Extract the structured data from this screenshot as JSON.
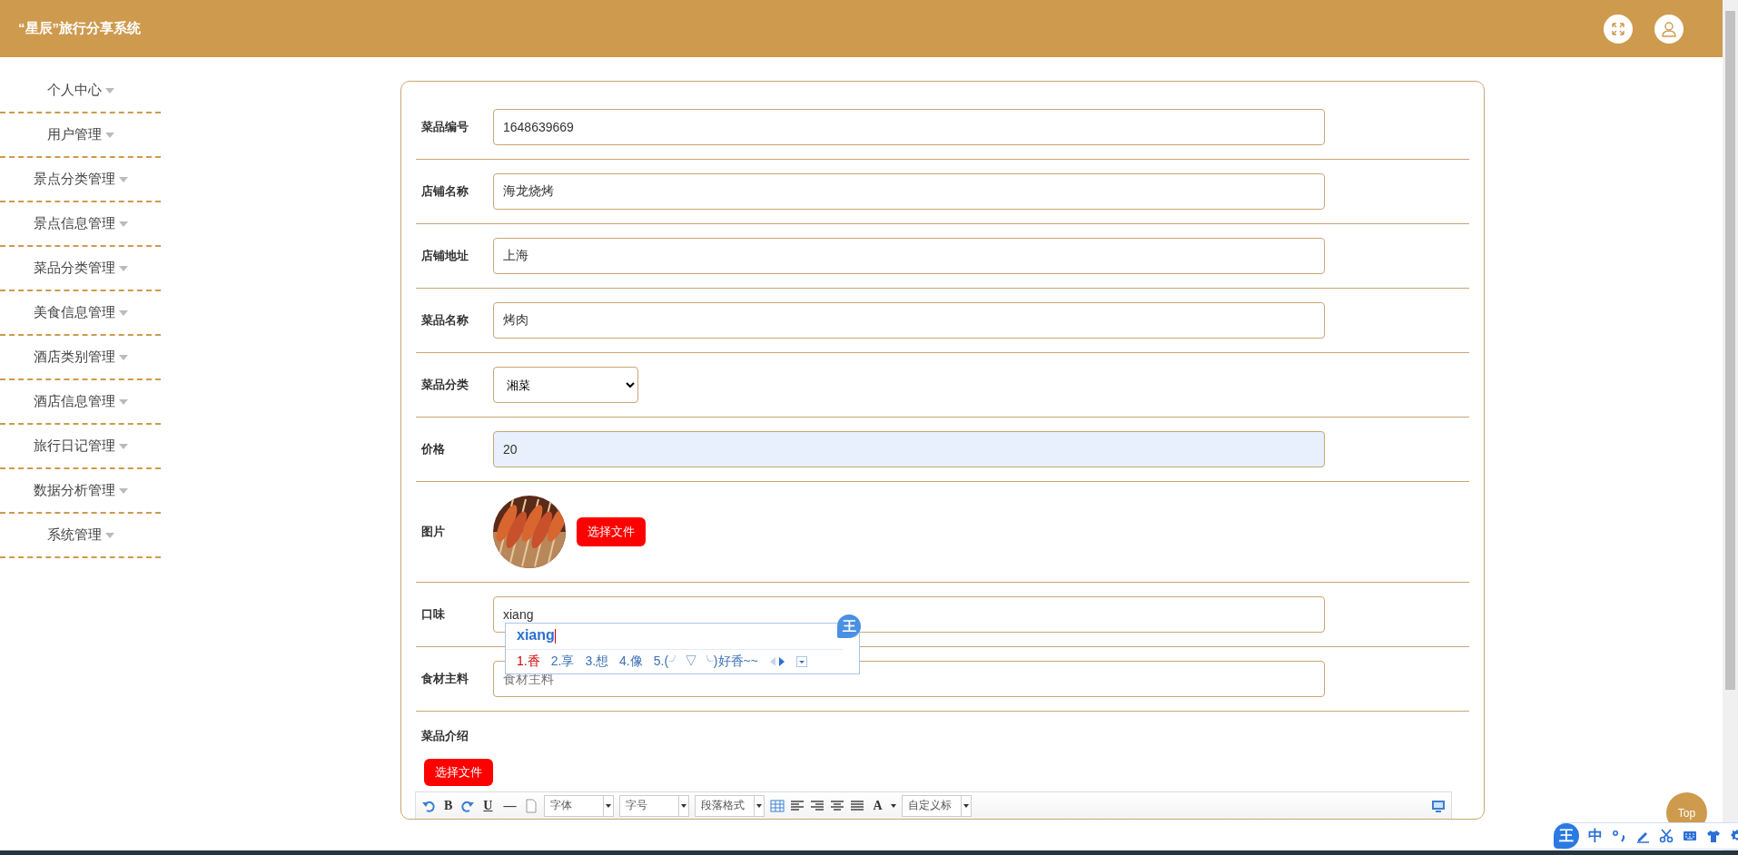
{
  "header": {
    "title": "“星辰”旅行分享系统"
  },
  "sidebar": {
    "items": [
      {
        "label": "个人中心"
      },
      {
        "label": "用户管理"
      },
      {
        "label": "景点分类管理"
      },
      {
        "label": "景点信息管理"
      },
      {
        "label": "菜品分类管理"
      },
      {
        "label": "美食信息管理"
      },
      {
        "label": "酒店类别管理"
      },
      {
        "label": "酒店信息管理"
      },
      {
        "label": "旅行日记管理"
      },
      {
        "label": "数据分析管理"
      },
      {
        "label": "系统管理"
      }
    ]
  },
  "form": {
    "fields": [
      {
        "kind": "text",
        "label": "菜品编号",
        "value": "1648639669",
        "autofilled": false
      },
      {
        "kind": "text",
        "label": "店铺名称",
        "value": "海龙烧烤",
        "autofilled": false
      },
      {
        "kind": "text",
        "label": "店铺地址",
        "value": "上海",
        "autofilled": false
      },
      {
        "kind": "text",
        "label": "菜品名称",
        "value": "烤肉",
        "autofilled": false
      },
      {
        "kind": "select",
        "label": "菜品分类",
        "value": "湘菜"
      },
      {
        "kind": "text",
        "label": "价格",
        "value": "20",
        "autofilled": true
      },
      {
        "label": "图片",
        "button": "选择文件"
      },
      {
        "kind": "text",
        "label": "口味",
        "value": "xiang",
        "autofilled": false,
        "ime": {
          "logo": "王",
          "composition": "xiang",
          "candidates": [
            {
              "text": "1.香",
              "selected": true
            },
            {
              "text": "2.享",
              "selected": false
            },
            {
              "text": "3.想",
              "selected": false
            },
            {
              "text": "4.像",
              "selected": false
            },
            {
              "text": "5.(╯ ▽ ╰)好香~~",
              "selected": false
            }
          ]
        }
      },
      {
        "kind": "text",
        "label": "食材主料",
        "placeholder": "食材主料",
        "autofilled": false
      },
      {
        "kind": "editor",
        "label": "菜品介绍",
        "button": "选择文件",
        "toolbar": [
          {
            "kind": "undo"
          },
          {
            "kind": "char",
            "label": "B"
          },
          {
            "kind": "redo"
          },
          {
            "kind": "char",
            "label": "U"
          },
          {
            "kind": "char",
            "label": "—"
          },
          {
            "kind": "page"
          },
          {
            "kind": "dropdown",
            "label": "字体"
          },
          {
            "kind": "dropdown",
            "label": "字号"
          },
          {
            "kind": "dropdown",
            "label": "段落格式"
          },
          {
            "kind": "table"
          },
          {
            "kind": "align-left"
          },
          {
            "kind": "align-right"
          },
          {
            "kind": "align-center"
          },
          {
            "kind": "justify"
          },
          {
            "kind": "color",
            "label": "A"
          },
          {
            "kind": "dropdown",
            "label": "自定义标"
          },
          {
            "kind": "preview"
          }
        ]
      }
    ]
  },
  "top_button": "Top",
  "ime_toolbar": {
    "logo": "王",
    "mode": "中"
  }
}
